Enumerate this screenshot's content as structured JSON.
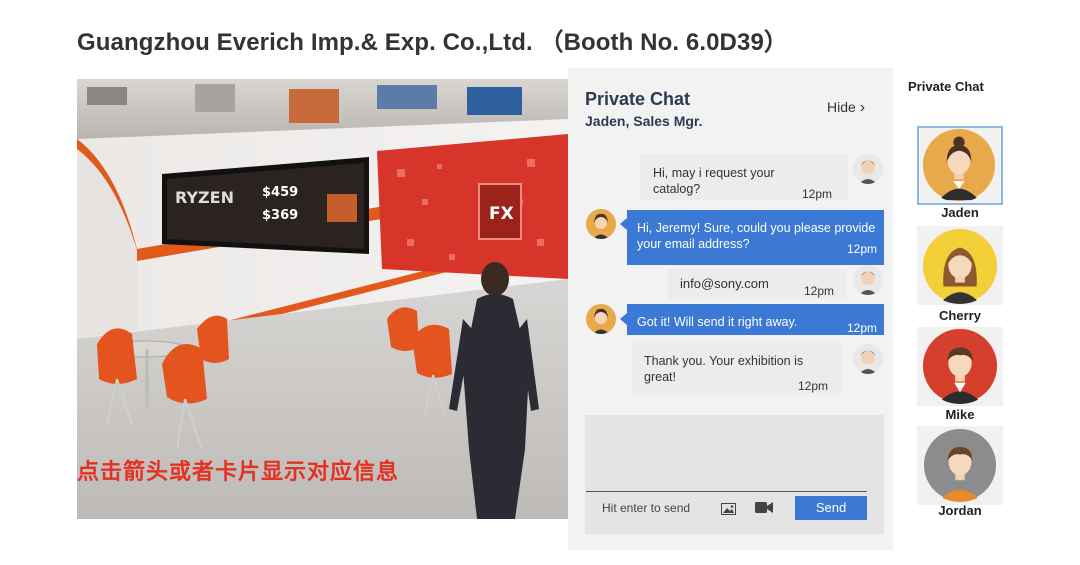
{
  "page": {
    "title": "Guangzhou Everich Imp.& Exp. Co.,Ltd. （Booth No. 6.0D39）"
  },
  "scene": {
    "overlay_text": "点击箭头或者卡片显示对应信息"
  },
  "chat": {
    "title": "Private Chat",
    "subtitle": "Jaden, Sales Mgr.",
    "hide_label": "Hide",
    "messages": [
      {
        "from": "visitor",
        "text": "Hi, may i request your catalog?",
        "time": "12pm"
      },
      {
        "from": "agent",
        "text": "Hi, Jeremy! Sure, could you please provide your email address?",
        "time": "12pm"
      },
      {
        "from": "visitor",
        "text": "info@sony.com",
        "time": "12pm"
      },
      {
        "from": "agent",
        "text": "Got it! Will send it right away.",
        "time": "12pm"
      },
      {
        "from": "visitor",
        "text": "Thank you. Your exhibition is great!",
        "time": "12pm"
      }
    ],
    "compose": {
      "placeholder": "Hit enter to send",
      "send_label": "Send",
      "image_icon": "image-icon",
      "video_icon": "video-camera-icon"
    }
  },
  "contacts": {
    "title": "Private Chat",
    "items": [
      {
        "name": "Jaden",
        "selected": true,
        "color": "#e8a94a"
      },
      {
        "name": "Cherry",
        "color": "#f3cf3a"
      },
      {
        "name": "Mike",
        "color": "#d43f2e"
      },
      {
        "name": "Jordan",
        "color": "#8c8c8c"
      }
    ]
  },
  "colors": {
    "accent": "#3b79d4",
    "title_text": "#2b3b52",
    "overlay_text": "#e43122"
  }
}
